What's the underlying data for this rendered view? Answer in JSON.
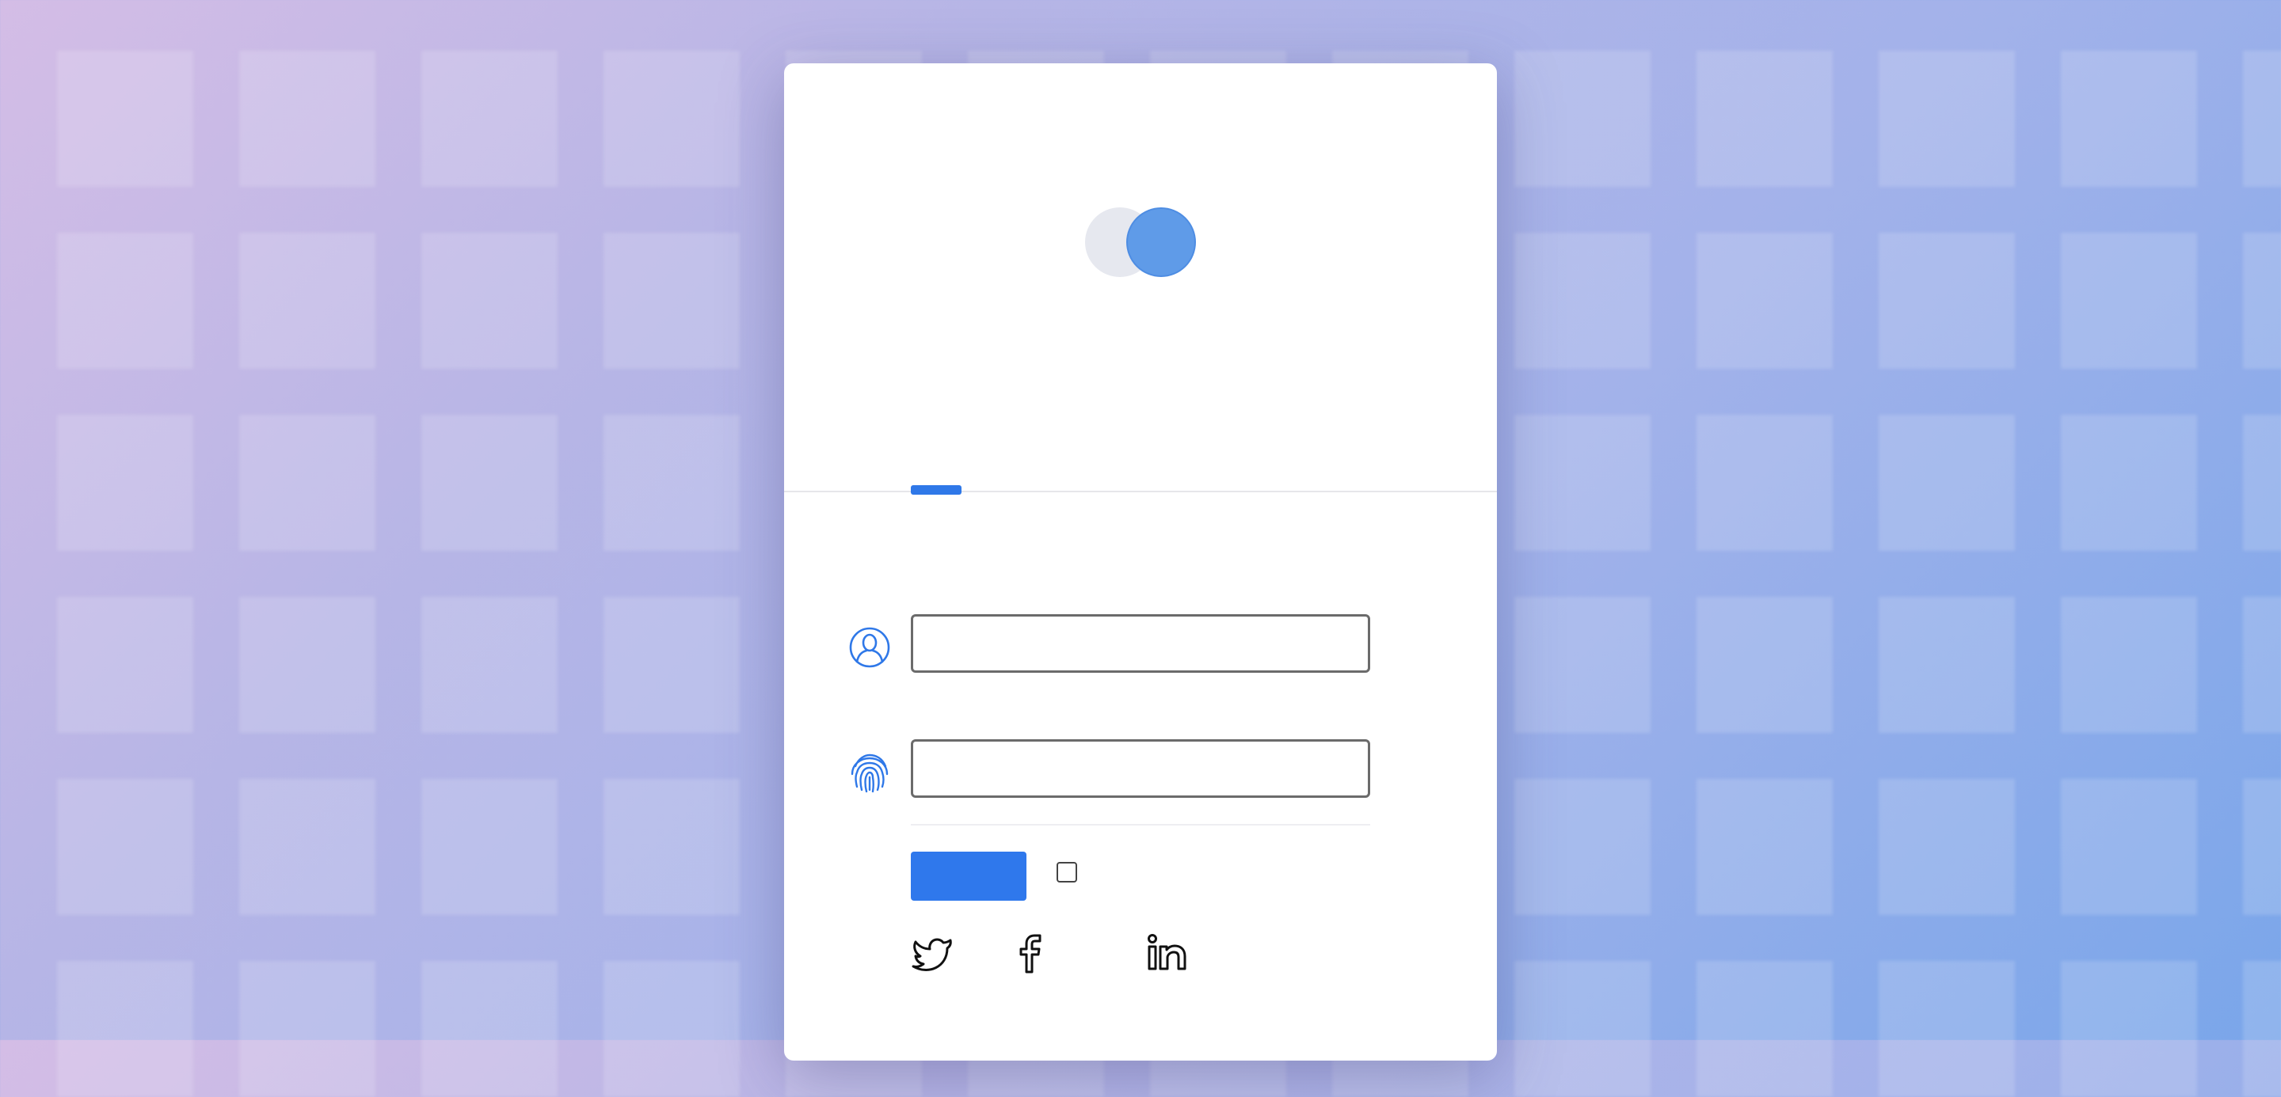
{
  "page": {
    "background_colors": [
      "#d4bde6",
      "#b6b5e6",
      "#a3b2ea",
      "#7aa6ea"
    ]
  },
  "card": {
    "logo": {
      "icon": "two-circles-logo",
      "colors": [
        "#e6e8ef",
        "#5f9be8"
      ]
    },
    "tab_indicator_color": "#2f78e8"
  },
  "form": {
    "username": {
      "icon": "user-icon",
      "value": "",
      "placeholder": ""
    },
    "password": {
      "icon": "fingerprint-icon",
      "value": "",
      "placeholder": ""
    },
    "submit_label": "",
    "remember_checked": false,
    "accent_color": "#2f78ec"
  },
  "social": {
    "items": [
      {
        "name": "twitter-icon"
      },
      {
        "name": "facebook-icon"
      },
      {
        "name": "linkedin-icon"
      }
    ]
  }
}
